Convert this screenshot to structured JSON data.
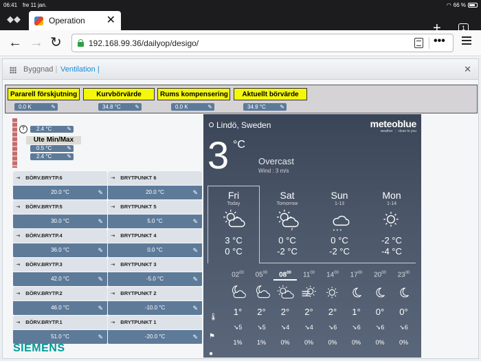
{
  "status": {
    "time": "06:41",
    "date": "fre 11 jan.",
    "battery": "66 %"
  },
  "browser": {
    "tab_title": "Operation",
    "tab_count": "1",
    "url": "192.168.99.36/dailyop/desigo/"
  },
  "app": {
    "breadcrumb_building": "Byggnad",
    "breadcrumb_ventilation": "Ventilation",
    "separator": "|"
  },
  "setpoints": [
    {
      "label": "Pararell förskjutning",
      "value": "0.0 K"
    },
    {
      "label": "Kurvbörvärde",
      "value": "34.8 °C"
    },
    {
      "label": "Rums kompensering",
      "value": "0.0 K"
    },
    {
      "label": "Aktuellt börvärde",
      "value": "34.9 °C"
    }
  ],
  "ute": {
    "title": "Ute Min/Max",
    "values": [
      "2.4 °C",
      "0.5 °C",
      "2.4 °C"
    ],
    "t_label": "T"
  },
  "curve": [
    {
      "left_label": "BÖRV.BRYTP.6",
      "left_value": "20.0 °C",
      "right_label": "BRYTPUNKT 6",
      "right_value": "20.0 °C"
    },
    {
      "left_label": "BÖRV.BRYTP.5",
      "left_value": "30.0 °C",
      "right_label": "BRYTPUNKT 5",
      "right_value": "5.0 °C"
    },
    {
      "left_label": "BÖRV.BRYTP.4",
      "left_value": "36.0 °C",
      "right_label": "BRYTPUNKT 4",
      "right_value": "0.0 °C"
    },
    {
      "left_label": "BÖRV.BRYTP.3",
      "left_value": "42.0 °C",
      "right_label": "BRYTPUNKT 3",
      "right_value": "-5.0 °C"
    },
    {
      "left_label": "BÖRV.BRYTP.2",
      "left_value": "46.0 °C",
      "right_label": "BRYTPUNKT 2",
      "right_value": "-10.0 °C"
    },
    {
      "left_label": "BÖRV.BRYTP.1",
      "left_value": "51.0 °C",
      "right_label": "BRYTPUNKT 1",
      "right_value": "-20.0 °C"
    }
  ],
  "brand": "SIEMENS",
  "weather": {
    "location": "Lindö, Sweden",
    "provider": "meteoblue",
    "provider_sub": "weather ⋮ close to you",
    "current_temp": "3",
    "unit": "°C",
    "condition": "Overcast",
    "wind": "Wind : 3 m/s",
    "days": [
      {
        "name": "Fri",
        "sub": "Today",
        "hi": "3 °C",
        "lo": "0 °C",
        "icon": "partly-cloudy-icon"
      },
      {
        "name": "Sat",
        "sub": "Tomorrow",
        "hi": "0 °C",
        "lo": "-2 °C",
        "icon": "cloudy-rain-icon"
      },
      {
        "name": "Sun",
        "sub": "1-13",
        "hi": "0 °C",
        "lo": "-2 °C",
        "icon": "cloudy-snow-icon"
      },
      {
        "name": "Mon",
        "sub": "1-14",
        "hi": "-2 °C",
        "lo": "-4 °C",
        "icon": "sunny-icon"
      }
    ],
    "hours": [
      {
        "h": "02",
        "m": "00",
        "temp": "1°",
        "wind": "5",
        "precip": "1%",
        "icon": "cloud-moon-icon"
      },
      {
        "h": "05",
        "m": "00",
        "temp": "2°",
        "wind": "5",
        "precip": "1%",
        "icon": "cloud-moon-icon"
      },
      {
        "h": "08",
        "m": "00",
        "temp": "2°",
        "wind": "4",
        "precip": "0%",
        "icon": "cloud-sun-icon"
      },
      {
        "h": "11",
        "m": "00",
        "temp": "2°",
        "wind": "4",
        "precip": "0%",
        "icon": "fog-sun-icon"
      },
      {
        "h": "14",
        "m": "00",
        "temp": "2°",
        "wind": "6",
        "precip": "0%",
        "icon": "sunny-icon"
      },
      {
        "h": "17",
        "m": "00",
        "temp": "1°",
        "wind": "6",
        "precip": "0%",
        "icon": "moon-icon"
      },
      {
        "h": "20",
        "m": "00",
        "temp": "0°",
        "wind": "6",
        "precip": "0%",
        "icon": "moon-icon"
      },
      {
        "h": "23",
        "m": "00",
        "temp": "0°",
        "wind": "6",
        "precip": "0%",
        "icon": "moon-icon"
      }
    ]
  }
}
